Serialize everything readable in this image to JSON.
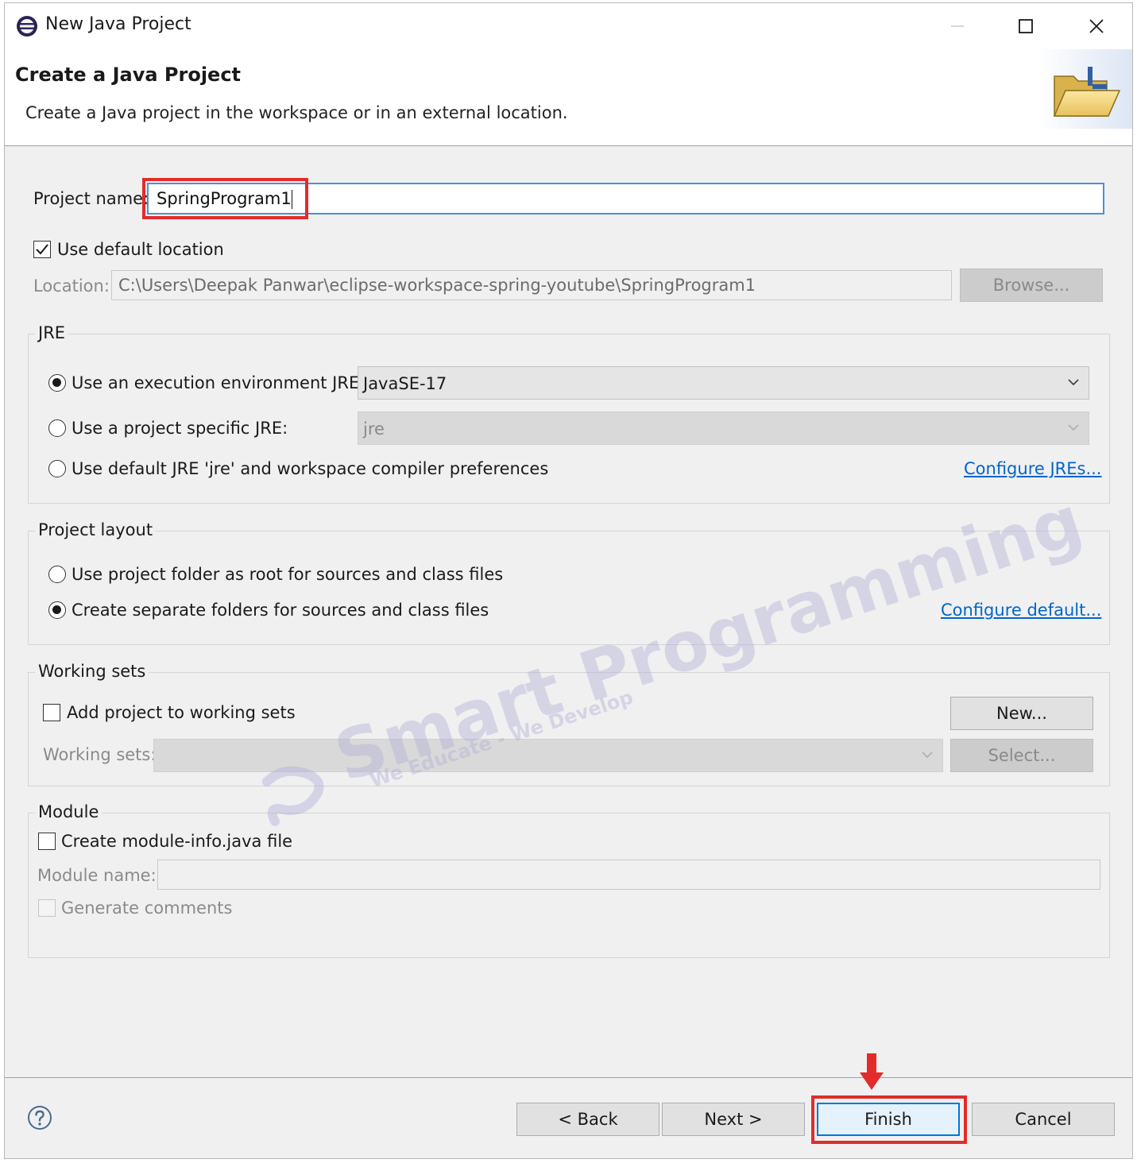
{
  "window": {
    "title": "New Java Project",
    "icons": {
      "app": "eclipse-icon",
      "minimize": "minimize-icon",
      "maximize": "maximize-icon",
      "close": "close-icon"
    }
  },
  "banner": {
    "title": "Create a Java Project",
    "description": "Create a Java project in the workspace or in an external location."
  },
  "project": {
    "name_label": "Project name:",
    "name_value": "SpringProgram1",
    "use_default_label": "Use default location",
    "use_default_checked": true,
    "location_label": "Location:",
    "location_value": "C:\\Users\\Deepak Panwar\\eclipse-workspace-spring-youtube\\SpringProgram1",
    "browse_label": "Browse..."
  },
  "jre": {
    "group_title": "JRE",
    "option_exec_env": "Use an execution environment JRE:",
    "exec_env_value": "JavaSE-17",
    "option_project_specific": "Use a project specific JRE:",
    "project_specific_value": "jre",
    "option_default": "Use default JRE 'jre' and workspace compiler preferences",
    "configure_link": "Configure JREs...",
    "selected": "exec_env"
  },
  "layout": {
    "group_title": "Project layout",
    "option_root": "Use project folder as root for sources and class files",
    "option_separate": "Create separate folders for sources and class files",
    "configure_link": "Configure default...",
    "selected": "separate"
  },
  "working_sets": {
    "group_title": "Working sets",
    "add_label": "Add project to working sets",
    "new_button": "New...",
    "sets_label": "Working sets:",
    "select_button": "Select..."
  },
  "module": {
    "group_title": "Module",
    "create_label": "Create module-info.java file",
    "name_label": "Module name:",
    "generate_label": "Generate comments"
  },
  "footer": {
    "back": "< Back",
    "next": "Next >",
    "finish": "Finish",
    "cancel": "Cancel",
    "help_icon": "help-icon"
  },
  "annotations": {
    "highlight_color": "#e32b2b",
    "arrow_icon": "red-down-arrow-icon"
  },
  "watermark": {
    "brand": "Smart Programming",
    "tagline": "We Educate - We Develop"
  },
  "colors": {
    "dialog_bg": "#f0f0f0",
    "focus_border": "#4a90d9",
    "link": "#0066cc",
    "default_button_border": "#0078d7"
  }
}
